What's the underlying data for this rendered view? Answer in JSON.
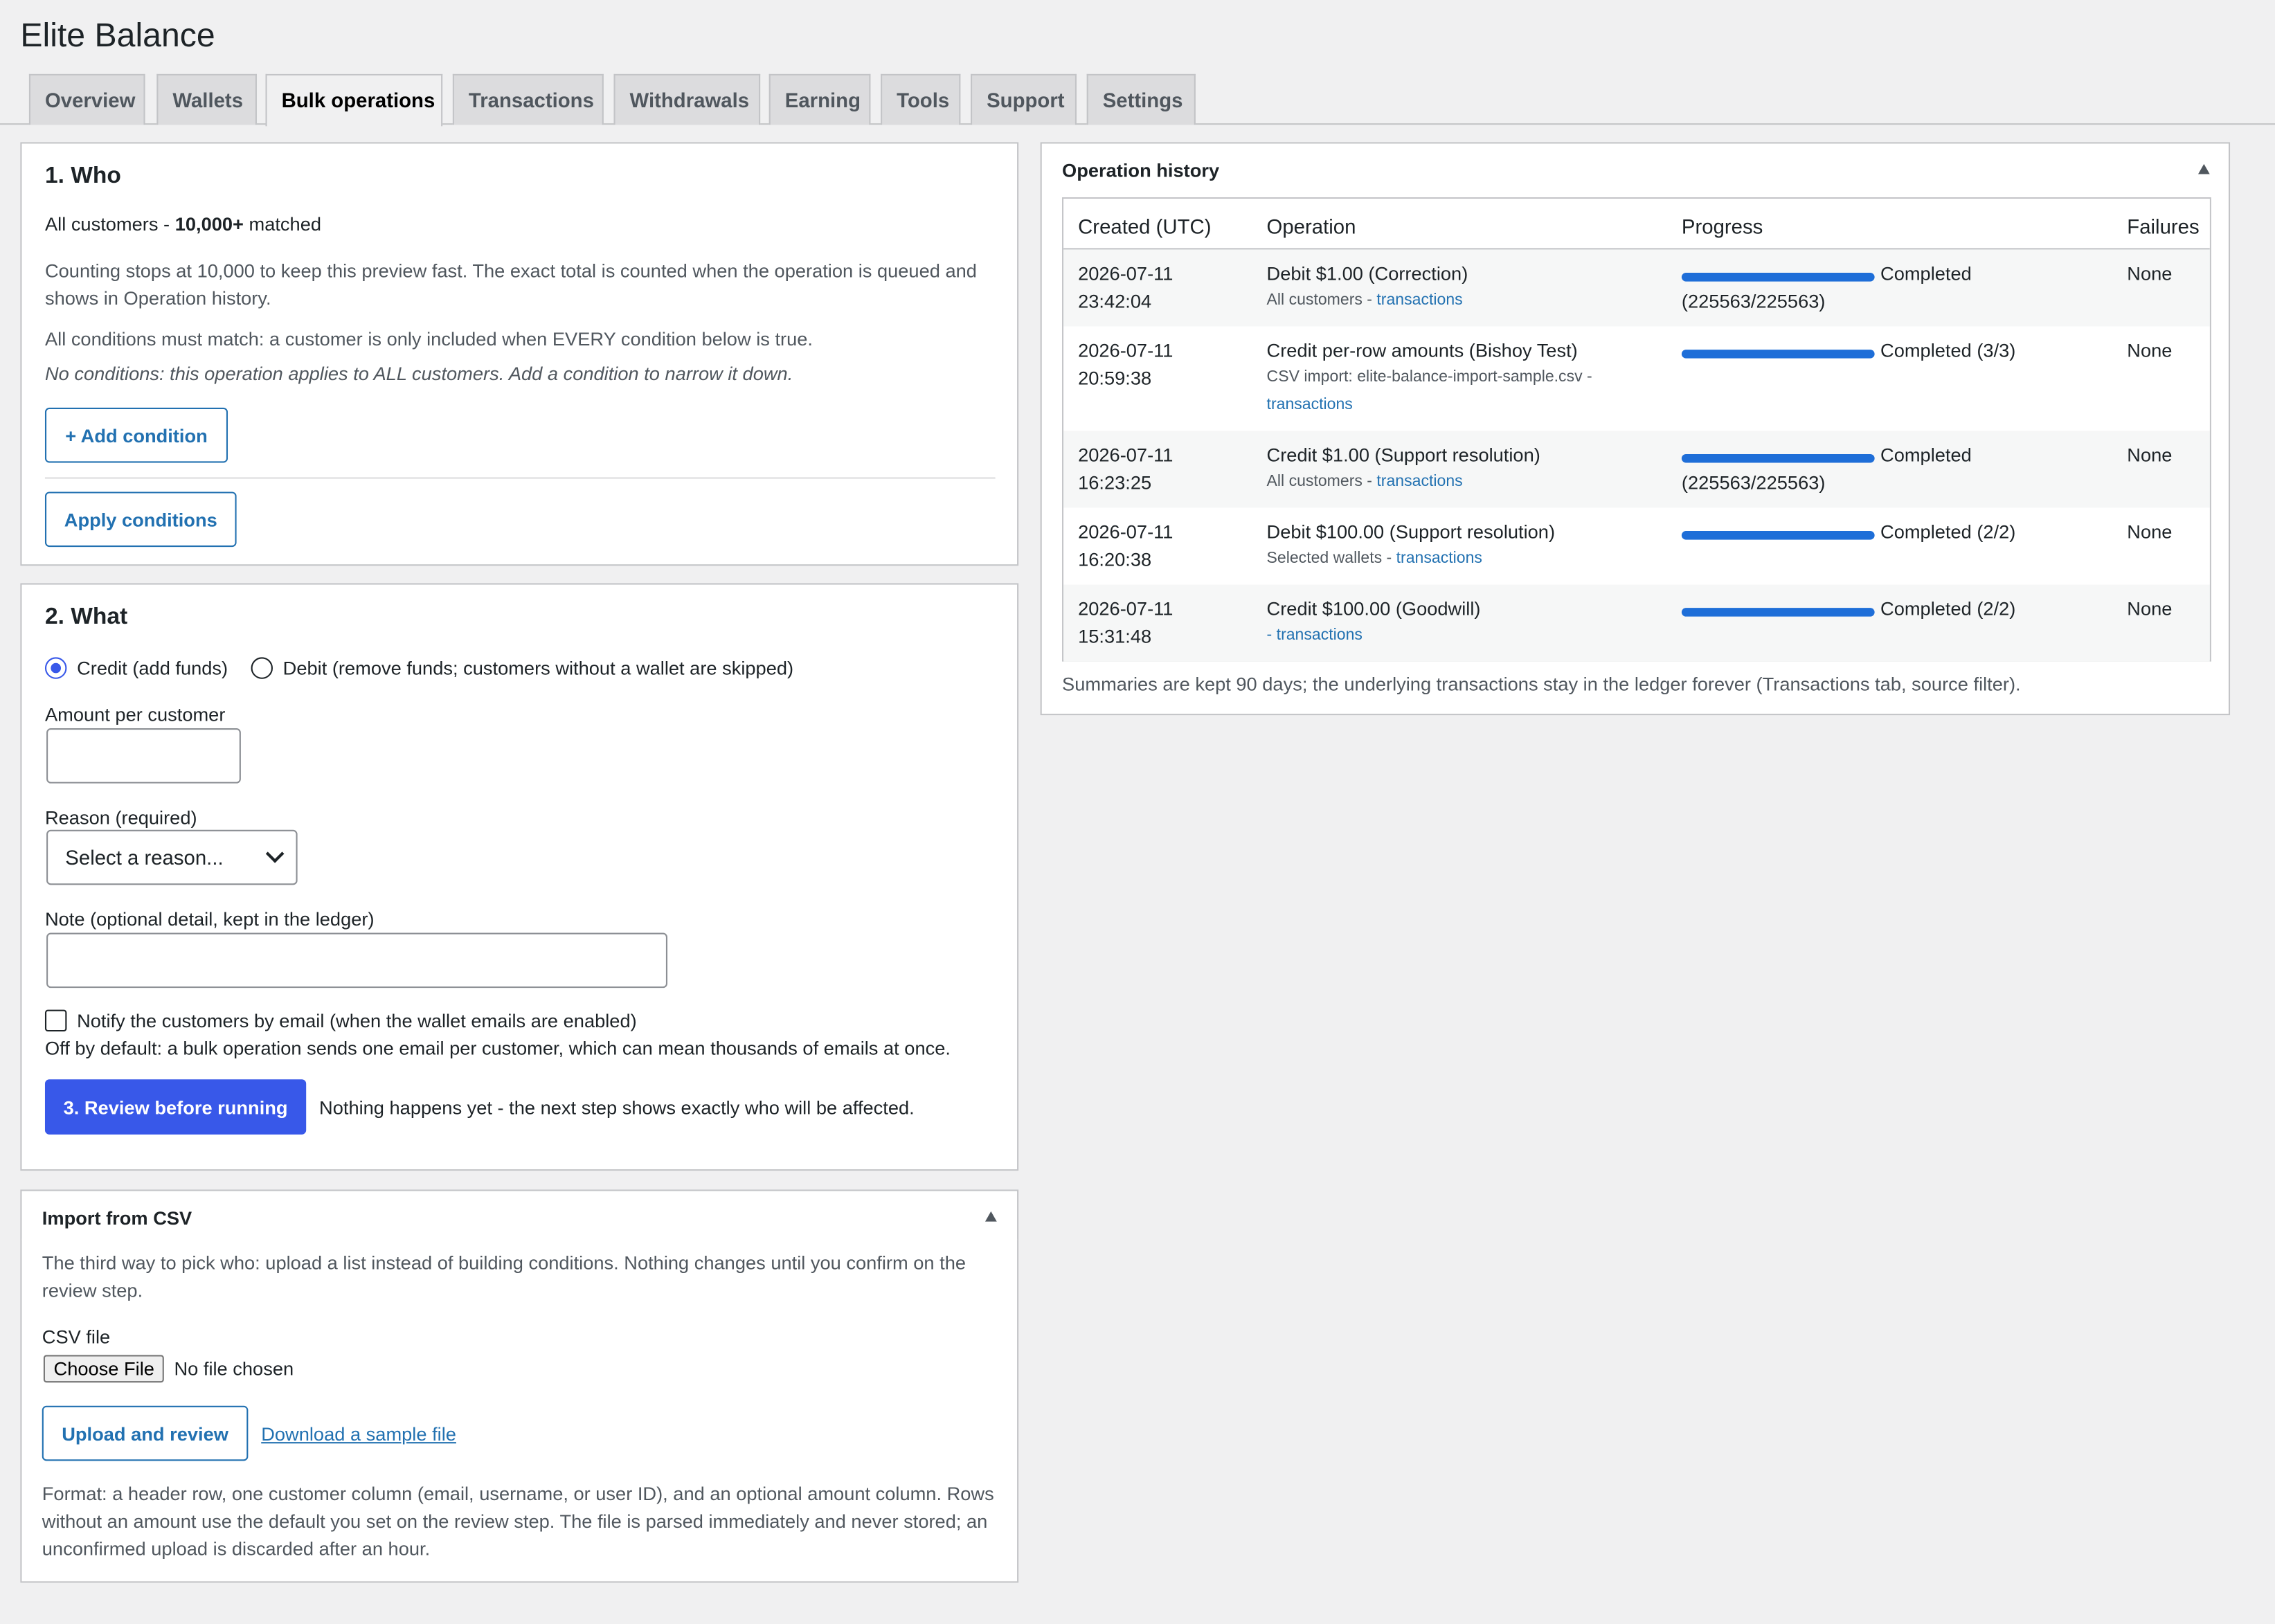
{
  "page_title": "Elite Balance",
  "tabs": [
    "Overview",
    "Wallets",
    "Bulk operations",
    "Transactions",
    "Withdrawals",
    "Earning",
    "Tools",
    "Support",
    "Settings"
  ],
  "active_tab": "Bulk operations",
  "who": {
    "heading": "1. Who",
    "summary_prefix": "All customers - ",
    "summary_count": "10,000+",
    "summary_suffix": " matched",
    "note_line1": "Counting stops at 10,000 to keep this preview fast. The exact total is counted when the operation is queued and",
    "note_line2": "shows in Operation history.",
    "conditions_rule": "All conditions must match: a customer is only included when EVERY condition below is true.",
    "no_conditions": "No conditions: this operation applies to ALL customers. Add a condition to narrow it down.",
    "add_condition_label": "+ Add condition",
    "apply_conditions_label": "Apply conditions"
  },
  "what": {
    "heading": "2. What",
    "credit_label": "Credit (add funds)",
    "debit_label": "Debit (remove funds; customers without a wallet are skipped)",
    "amount_label": "Amount per customer",
    "amount_value": "",
    "reason_label": "Reason (required)",
    "reason_value": "Select a reason...",
    "note_label": "Note (optional detail, kept in the ledger)",
    "note_value": "",
    "notify_label": "Notify the customers by email (when the wallet emails are enabled)",
    "notify_help": "Off by default: a bulk operation sends one email per customer, which can mean thousands of emails at once.",
    "review_label": "3. Review before running",
    "review_help": "Nothing happens yet - the next step shows exactly who will be affected."
  },
  "csv": {
    "heading": "Import from CSV",
    "intro_line1": "The third way to pick who: upload a list instead of building conditions. Nothing changes until you confirm on the",
    "intro_line2": "review step.",
    "file_label": "CSV file",
    "choose_file_label": "Choose File",
    "no_file_text": "No file chosen",
    "upload_label": "Upload and review",
    "sample_link": "Download a sample file",
    "format_line1": "Format: a header row, one customer column (email, username, or user ID), and an optional amount column. Rows",
    "format_line2": "without an amount use the default you set on the review step. The file is parsed immediately and never stored; an",
    "format_line3": "unconfirmed upload is discarded after an hour."
  },
  "history": {
    "heading": "Operation history",
    "columns": [
      "Created (UTC)",
      "Operation",
      "Progress",
      "Failures"
    ],
    "rows": [
      {
        "date": "2026-07-11",
        "time": "23:42:04",
        "op": "Debit $1.00 (Correction)",
        "sub": "All customers - ",
        "sub2": "",
        "link": "transactions",
        "progress": 1.0,
        "status": "Completed",
        "status2": "(225563/225563)",
        "failures": "None"
      },
      {
        "date": "2026-07-11",
        "time": "20:59:38",
        "op": "Credit per-row amounts (Bishoy Test)",
        "sub": "CSV import: elite-balance-import-sample.csv -",
        "sub2": "",
        "link": "transactions",
        "progress": 1.0,
        "status": "Completed (3/3)",
        "status2": "",
        "failures": "None"
      },
      {
        "date": "2026-07-11",
        "time": "16:23:25",
        "op": "Credit $1.00 (Support resolution)",
        "sub": "All customers - ",
        "sub2": "",
        "link": "transactions",
        "progress": 1.0,
        "status": "Completed",
        "status2": "(225563/225563)",
        "failures": "None"
      },
      {
        "date": "2026-07-11",
        "time": "16:20:38",
        "op": "Debit $100.00 (Support resolution)",
        "sub": "Selected wallets - ",
        "sub2": "",
        "link": "transactions",
        "progress": 1.0,
        "status": "Completed (2/2)",
        "status2": "",
        "failures": "None"
      },
      {
        "date": "2026-07-11",
        "time": "15:31:48",
        "op": "Credit $100.00 (Goodwill)",
        "sub": "- ",
        "sub2": "",
        "link": "transactions",
        "progress": 1.0,
        "status": "Completed (2/2)",
        "status2": "",
        "failures": "None"
      }
    ],
    "footer": "Summaries are kept 90 days; the underlying transactions stay in the ledger forever (Transactions tab, source filter)."
  },
  "colors": {
    "accent": "#3858e9",
    "link": "#2271b1",
    "progress": "#1e6ed8"
  },
  "icons": [
    "collapse-arrow-icon",
    "chevron-down-icon"
  ]
}
